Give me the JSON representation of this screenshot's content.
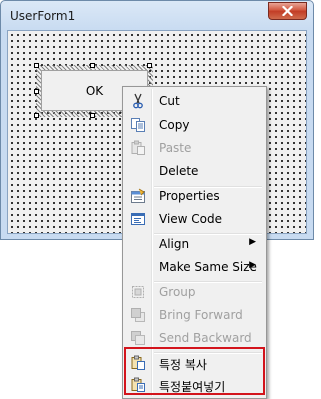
{
  "window": {
    "title": "UserForm1",
    "close_icon": "close-icon"
  },
  "form": {
    "ok_button_label": "OK"
  },
  "menu": {
    "items": [
      {
        "label": "Cut",
        "icon": "scissors-icon",
        "enabled": true
      },
      {
        "label": "Copy",
        "icon": "copy-icon",
        "enabled": true
      },
      {
        "label": "Paste",
        "icon": "paste-icon",
        "enabled": false
      },
      {
        "label": "Delete",
        "icon": "",
        "enabled": true
      },
      {
        "label": "Properties",
        "icon": "properties-icon",
        "enabled": true
      },
      {
        "label": "View Code",
        "icon": "view-code-icon",
        "enabled": true
      },
      {
        "label": "Align",
        "icon": "",
        "enabled": true,
        "submenu": true
      },
      {
        "label": "Make Same Size",
        "icon": "",
        "enabled": true,
        "submenu": true
      },
      {
        "label": "Group",
        "icon": "group-icon",
        "enabled": false
      },
      {
        "label": "Bring Forward",
        "icon": "bring-forward-icon",
        "enabled": false
      },
      {
        "label": "Send Backward",
        "icon": "send-backward-icon",
        "enabled": false
      },
      {
        "label": "특정 복사",
        "icon": "special-copy-icon",
        "enabled": true
      },
      {
        "label": "특정붙여넣기",
        "icon": "special-paste-icon",
        "enabled": true
      }
    ],
    "submenu_arrow": "▶"
  },
  "colors": {
    "highlight_border": "#d3141c",
    "close_button": "#c23c25"
  }
}
